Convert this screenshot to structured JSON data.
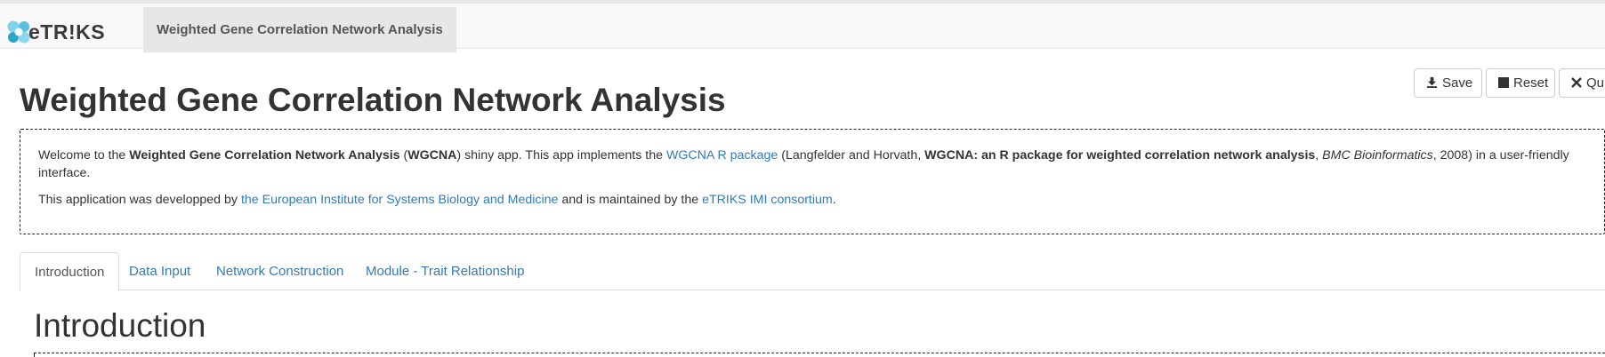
{
  "navbar": {
    "brand_text": "eTR!KS",
    "active_tab": "Weighted Gene Correlation Network Analysis"
  },
  "toolbar": {
    "save_label": "Save",
    "reset_label": "Reset",
    "quit_label": "Quit"
  },
  "page_title": "Weighted Gene Correlation Network Analysis",
  "intro": {
    "p1": {
      "t1": "Welcome to the ",
      "b1": "Weighted Gene Correlation Network Analysis",
      "t2": " (",
      "b2": "WGCNA",
      "t3": ") shiny app. This app implements the ",
      "link1": "WGCNA R package",
      "t4": " (Langfelder and Horvath, ",
      "b3": "WGCNA: an R package for weighted correlation network analysis",
      "t5": ", ",
      "i1": "BMC Bioinformatics",
      "t6": ", 2008) in a user-friendly interface."
    },
    "p2": {
      "t1": "This application was developped by ",
      "link1": "the European Institute for Systems Biology and Medicine",
      "t2": " and is maintained by the ",
      "link2": "eTRIKS IMI consortium",
      "t3": "."
    }
  },
  "tabs": [
    {
      "label": "Introduction",
      "active": true
    },
    {
      "label": "Data Input",
      "active": false
    },
    {
      "label": "Network Construction",
      "active": false
    },
    {
      "label": "Module - Trait Relationship",
      "active": false
    }
  ],
  "section_title": "Introduction",
  "colors": {
    "link": "#337ab7",
    "logo_primary": "#5bc0de",
    "logo_secondary": "#2aa6c9"
  },
  "icons": {
    "save": "download-icon",
    "reset": "stop-icon",
    "quit": "close-icon"
  }
}
